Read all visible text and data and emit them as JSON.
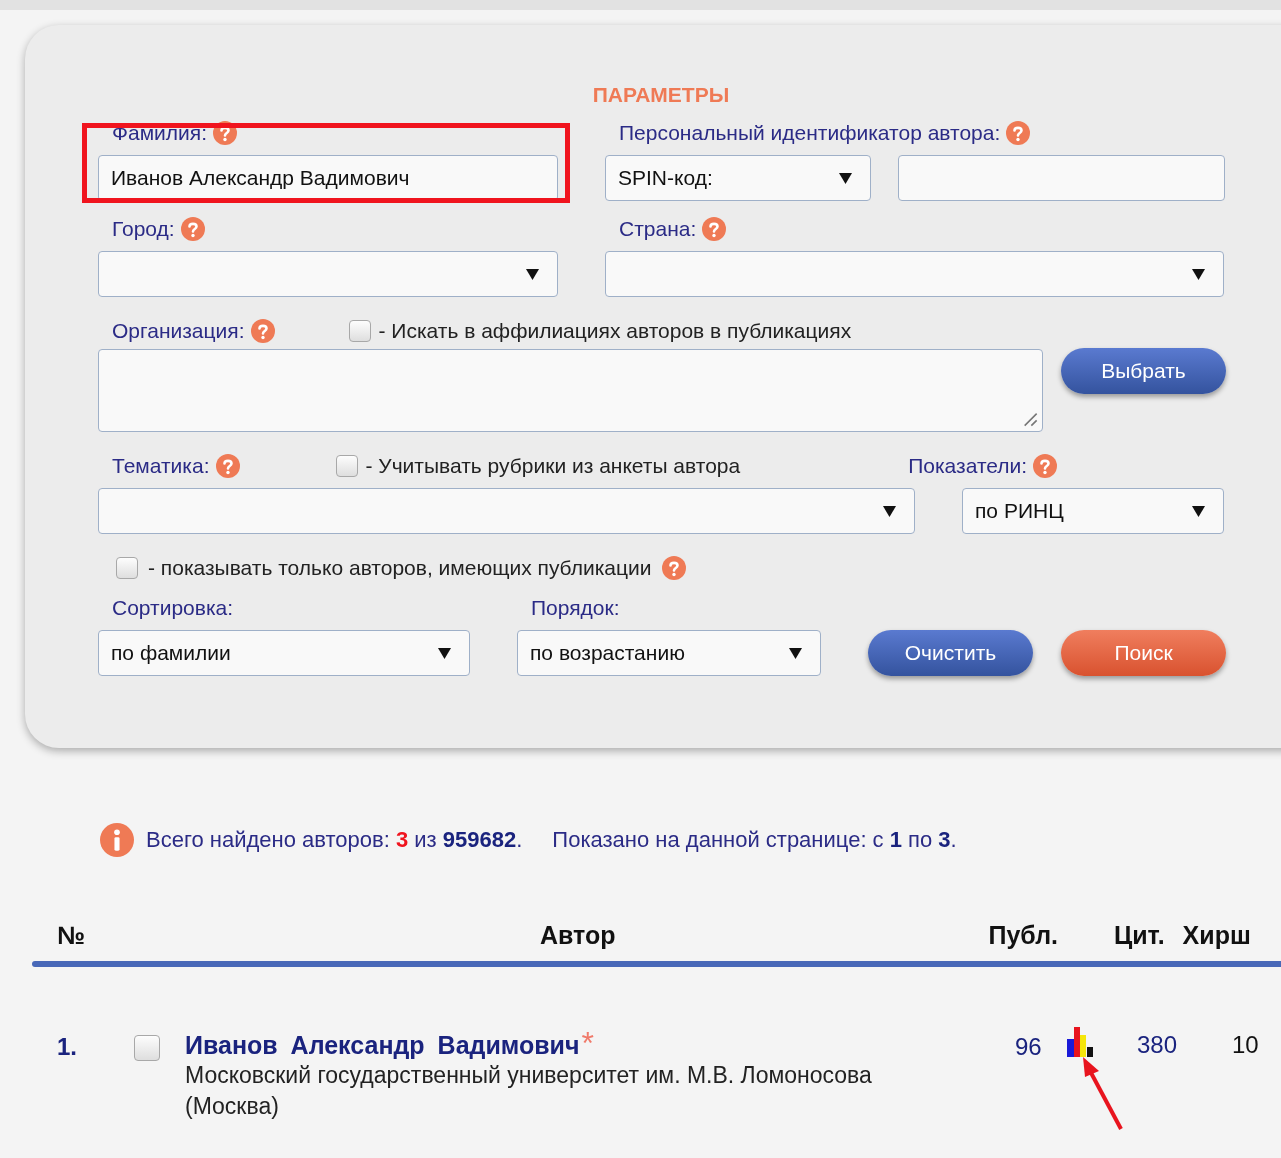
{
  "panel": {
    "title": "ПАРАМЕТРЫ",
    "surname": {
      "label": "Фамилия:",
      "value": "Иванов Александр Вадимович",
      "highlighted": true
    },
    "author_id": {
      "label": "Персональный идентификатор автора:",
      "type_select": "SPIN-код:"
    },
    "city": {
      "label": "Город:"
    },
    "country": {
      "label": "Страна:"
    },
    "organization": {
      "label": "Организация:",
      "checkbox": {
        "label": "- Искать в аффилиациях авторов в публикациях",
        "checked": false
      },
      "button": "Выбрать"
    },
    "topic": {
      "label": "Тематика:",
      "checkbox": {
        "label": "- Учитывать рубрики из анкеты автора",
        "checked": false
      }
    },
    "indicators": {
      "label": "Показатели:",
      "value": "по РИНЦ"
    },
    "only_with_publications": {
      "label": "- показывать только авторов, имеющих публикации",
      "checked": false
    },
    "sort": {
      "label": "Сортировка:",
      "value": "по фамилии"
    },
    "order": {
      "label": "Порядок:",
      "value": "по возрастанию"
    },
    "buttons": [
      {
        "label": "Очистить",
        "kind": "secondary"
      },
      {
        "label": "Поиск",
        "kind": "primary"
      }
    ]
  },
  "summary": {
    "found": "Всего найдено авторов: **3** из **959682**.",
    "shown": "Показано на данной странице: с **1** по **3**."
  },
  "table": {
    "columns": [
      "№",
      "Автор",
      "Публ.",
      "Цит.",
      "Хирш"
    ],
    "rows": [
      {
        "number": "1.",
        "selected": false,
        "name": "Иванов Александр Вадимович",
        "marker": "*",
        "affiliation": "Московский государственный университет им. М.В. Ломоносова (Москва)",
        "publications": "96",
        "citations": "380",
        "h_index": "10",
        "arrow": true
      }
    ]
  }
}
